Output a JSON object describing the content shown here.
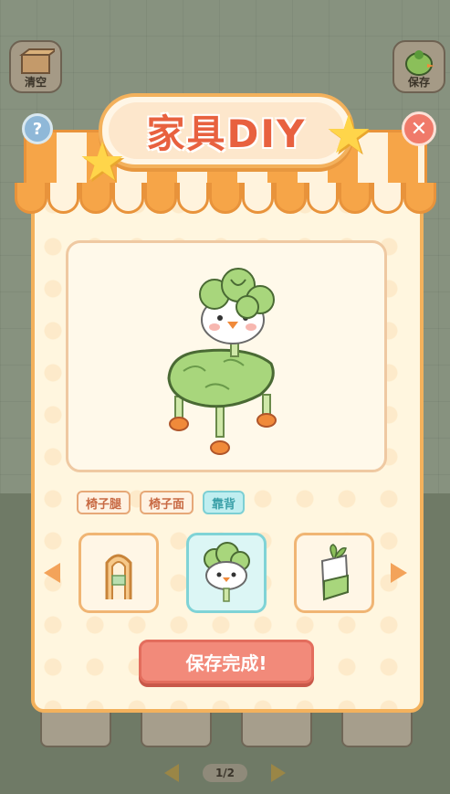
{
  "background": {
    "clear_label": "清空",
    "save_label": "保存",
    "page_indicator": "1/2"
  },
  "dialog": {
    "title": "家具DIY",
    "help_symbol": "?",
    "close_symbol": "✕",
    "tabs": [
      {
        "label": "椅子腿",
        "selected": false
      },
      {
        "label": "椅子面",
        "selected": false
      },
      {
        "label": "靠背",
        "selected": true
      }
    ],
    "options": [
      {
        "icon": "arch-backrest-icon",
        "selected": false
      },
      {
        "icon": "cabbage-backrest-icon",
        "selected": true
      },
      {
        "icon": "radish-backrest-icon",
        "selected": false
      }
    ],
    "save_done_label": "保存完成!"
  },
  "colors": {
    "accent_orange": "#f3b15c",
    "title_red": "#e8613f",
    "selected_teal": "#7fd3d6",
    "save_button": "#f28a7a"
  }
}
